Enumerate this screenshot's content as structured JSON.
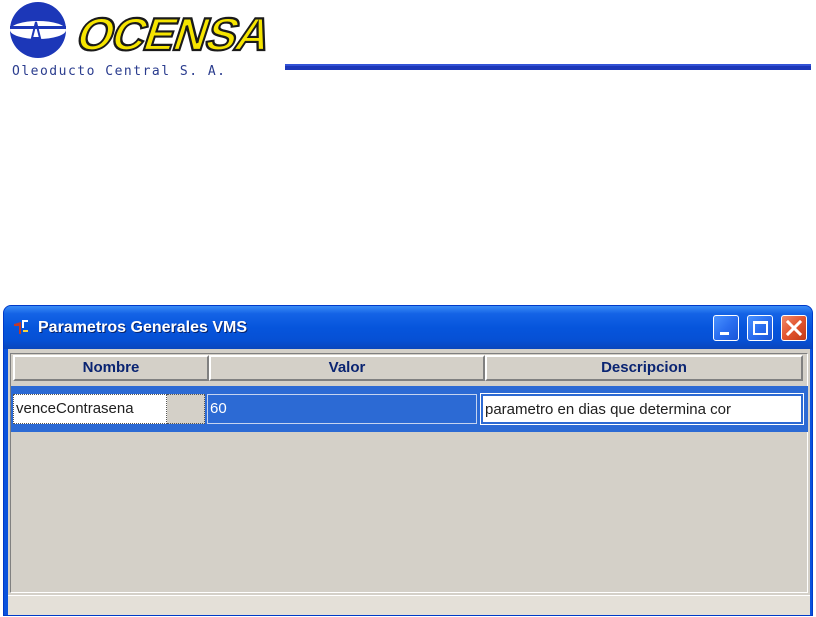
{
  "header": {
    "logo_text": "OCENSA",
    "tagline": "Oleoducto Central S. A."
  },
  "window": {
    "title": "Parametros Generales VMS",
    "controls": {
      "minimize": "minimize-icon",
      "maximize": "maximize-icon",
      "close": "close-icon"
    }
  },
  "table": {
    "columns": [
      "Nombre",
      "Valor",
      "Descripcion"
    ],
    "rows": [
      {
        "nombre": "venceContrasena",
        "valor": "60",
        "descripcion": "parametro en dias que determina cor"
      }
    ],
    "selection_color": "#2c6ad4"
  },
  "colors": {
    "titlebar": "#0655dc",
    "header_text": "#0a2472",
    "logo_yellow": "#f6e500",
    "logo_blue": "#1c37b8"
  }
}
